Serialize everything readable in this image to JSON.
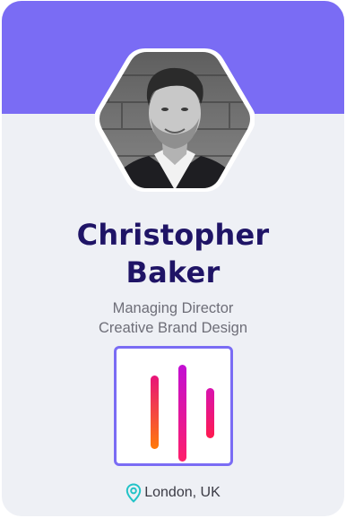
{
  "profile": {
    "first_name": "Christopher",
    "last_name": "Baker",
    "role": "Managing Director",
    "company": "Creative Brand Design",
    "location": "London, UK"
  },
  "icons": {
    "location": "map-pin-icon",
    "logo": "brand-bars-logo"
  },
  "colors": {
    "header": "#7a6cf4",
    "card_background": "#eef0f5",
    "name_text": "#1f1466",
    "logo_border": "#7a6cf4",
    "location_pin": "#22c3c7",
    "logo_gradient_top": "#c20fd4",
    "logo_gradient_bottom": "#ff8a00"
  }
}
